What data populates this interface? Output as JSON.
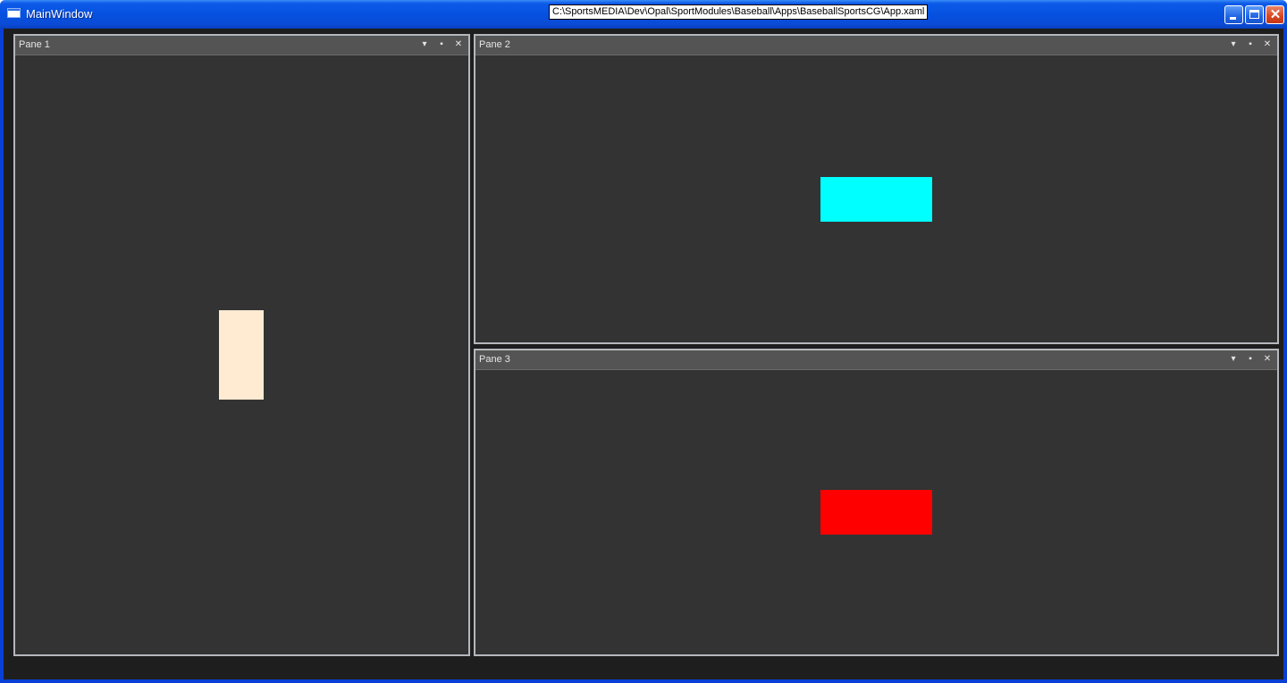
{
  "window": {
    "title": "MainWindow",
    "path_tooltip": "C:\\SportsMEDIA\\Dev\\Opal\\SportModules\\Baseball\\Apps\\BaseballSportsCG\\App.xaml",
    "controls": {
      "minimize": "minimize",
      "maximize": "maximize",
      "close": "✕"
    }
  },
  "panes": [
    {
      "title": "Pane 1",
      "shape_color": "#FFEBD2"
    },
    {
      "title": "Pane 2",
      "shape_color": "#00FFFF"
    },
    {
      "title": "Pane 3",
      "shape_color": "#FF0000"
    }
  ],
  "pane_buttons": {
    "dropdown": "▾",
    "pin": "▪",
    "close": "✕"
  },
  "colors": {
    "titlebar": "#0651E0",
    "pane_background": "#333333",
    "pane_header": "#545454",
    "pane_border": "#B4B8BC"
  }
}
